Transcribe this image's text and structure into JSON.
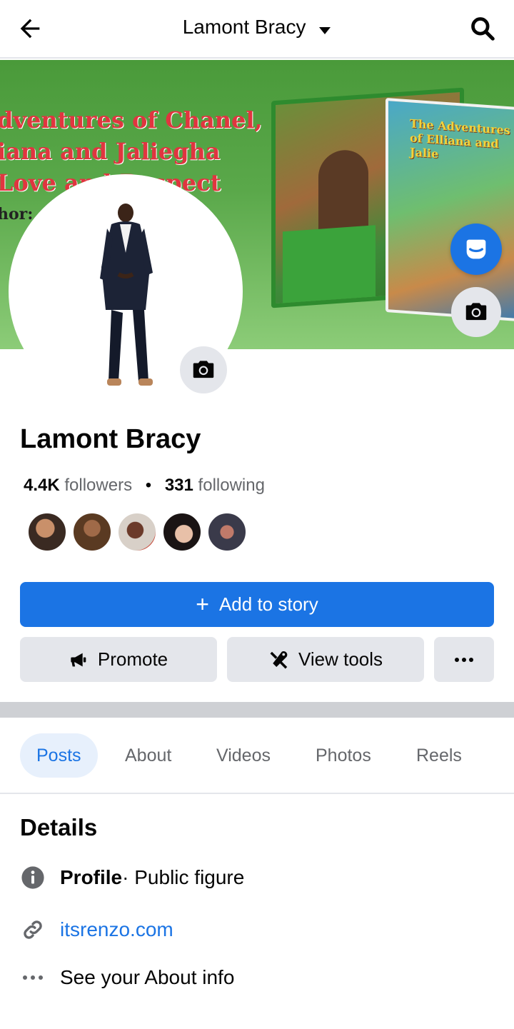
{
  "header": {
    "title": "Lamont Bracy"
  },
  "cover": {
    "text_lines": [
      "dventures of Chanel,",
      "iana and Jaliegha",
      "Love and Respect"
    ],
    "author_fragment": "hor:",
    "book_title": "The Adventures of Elliana and Jalie"
  },
  "profile": {
    "name": "Lamont Bracy",
    "followers_count": "4.4K",
    "followers_label": "followers",
    "separator": "•",
    "following_count": "331",
    "following_label": "following"
  },
  "actions": {
    "add_story": "Add to story",
    "promote": "Promote",
    "view_tools": "View tools"
  },
  "tabs": [
    {
      "label": "Posts",
      "active": true
    },
    {
      "label": "About",
      "active": false
    },
    {
      "label": "Videos",
      "active": false
    },
    {
      "label": "Photos",
      "active": false
    },
    {
      "label": "Reels",
      "active": false
    }
  ],
  "details": {
    "title": "Details",
    "profile_label": "Profile",
    "profile_value": " · Public figure",
    "website": "itsrenzo.com",
    "about_info": "See your About info"
  },
  "colors": {
    "accent": "#1b74e4",
    "secondary_button": "#e4e6eb",
    "text_muted": "#65676b"
  },
  "icons": [
    "back-arrow-icon",
    "caret-down-icon",
    "search-icon",
    "camera-icon",
    "messenger-icon",
    "megaphone-icon",
    "tools-icon",
    "more-horizontal-icon",
    "info-icon",
    "link-icon"
  ]
}
